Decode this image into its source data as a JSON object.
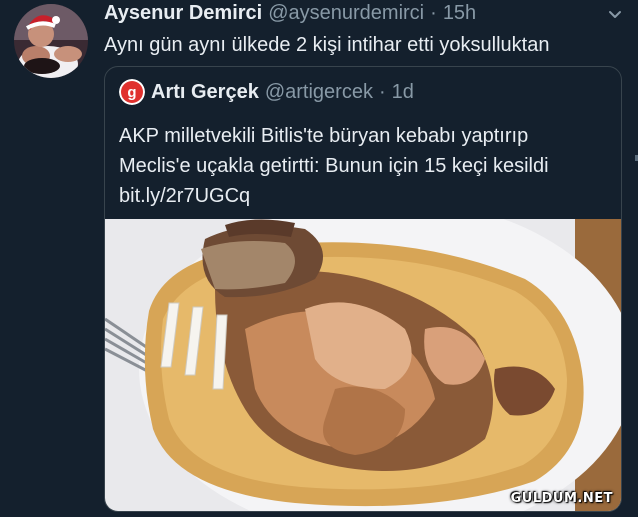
{
  "tweet": {
    "author": {
      "display_name": "Aysenur Demirci",
      "handle": "@aysenurdemirci",
      "separator": "·",
      "time": "15h",
      "avatar_icon": "user-avatar"
    },
    "text": "Aynı gün aynı ülkede 2 kişi intihar etti yoksulluktan",
    "menu_icon": "chevron-down-icon"
  },
  "quoted_tweet": {
    "author": {
      "display_name": "Artı Gerçek",
      "handle": "@artigercek",
      "separator": "·",
      "time": "1d",
      "avatar_icon": "arti-gercek-logo",
      "avatar_letter": "g",
      "brand_color": "#e0312e"
    },
    "text_lines": [
      "AKP milletvekili Bitlis'te büryan kebabı yaptırıp",
      "Meclis'e uçakla getirtti: Bunun için 15 keçi kesildi",
      "bit.ly/2r7UGCq"
    ],
    "media": {
      "description_icon": "food-photo"
    }
  },
  "watermark": "GULDUM.NET",
  "colors": {
    "background": "#14202d",
    "text": "#e8edf2",
    "muted": "#8899a6",
    "border": "#38444d"
  }
}
